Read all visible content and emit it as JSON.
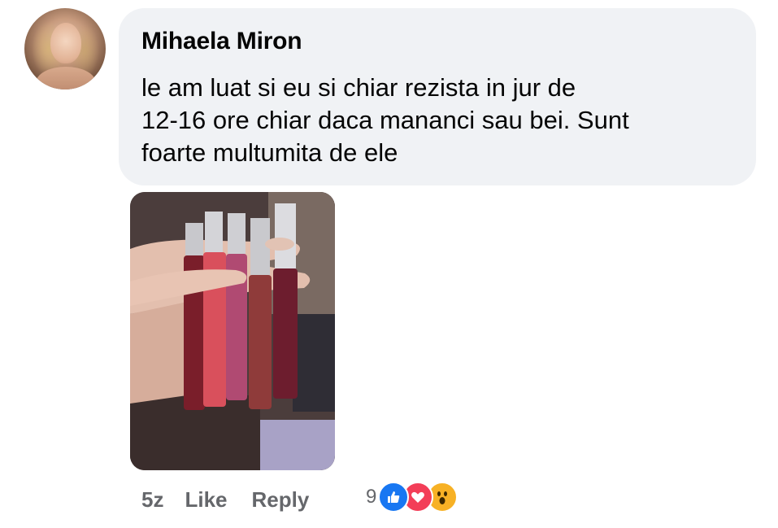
{
  "comment": {
    "author": "Mihaela Miron",
    "text_lines": [
      "le am luat si eu si chiar rezista in jur de",
      "12-16 ore chiar daca mananci sau bei. Sunt",
      "foarte multumita de ele"
    ],
    "timestamp": "5z",
    "like_label": "Like",
    "reply_label": "Reply",
    "reaction_count": "9",
    "reactions": [
      "like-icon",
      "love-icon",
      "wow-icon"
    ]
  },
  "colors": {
    "bubble": "#f0f2f5",
    "meta_text": "#65676b",
    "like": "#1877f2",
    "love": "#f33e58",
    "wow": "#f7b125"
  }
}
